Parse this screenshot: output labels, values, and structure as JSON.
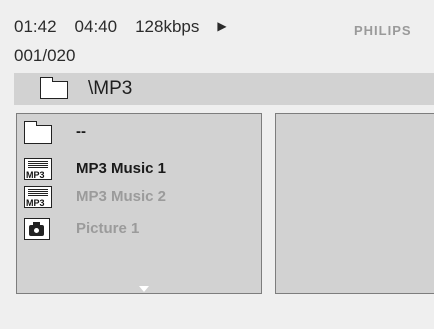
{
  "status": {
    "elapsed_time": "01:42",
    "total_time": "04:40",
    "bitrate": "128kbps",
    "play_icon": "play-icon",
    "track_counter": "001/020",
    "brand": "PHILIPS"
  },
  "path": {
    "icon": "folder-icon",
    "current": "\\MP3"
  },
  "file_list": {
    "items": [
      {
        "icon": "folder-icon",
        "label": "--",
        "state": "normal"
      },
      {
        "icon": "mp3-file-icon",
        "label": "MP3 Music 1",
        "state": "highlighted"
      },
      {
        "icon": "mp3-file-icon",
        "label": "MP3 Music 2",
        "state": "dimmed"
      },
      {
        "icon": "picture-file-icon",
        "label": "Picture 1",
        "state": "dimmed"
      }
    ],
    "scroll_icon": "scroll-down-arrow-icon"
  },
  "colors": {
    "background": "#efefef",
    "panel": "#d2d2d2",
    "text": "#1a1a1a",
    "dimmed_text": "#9b9b9b",
    "brand": "#9a9a9a"
  }
}
